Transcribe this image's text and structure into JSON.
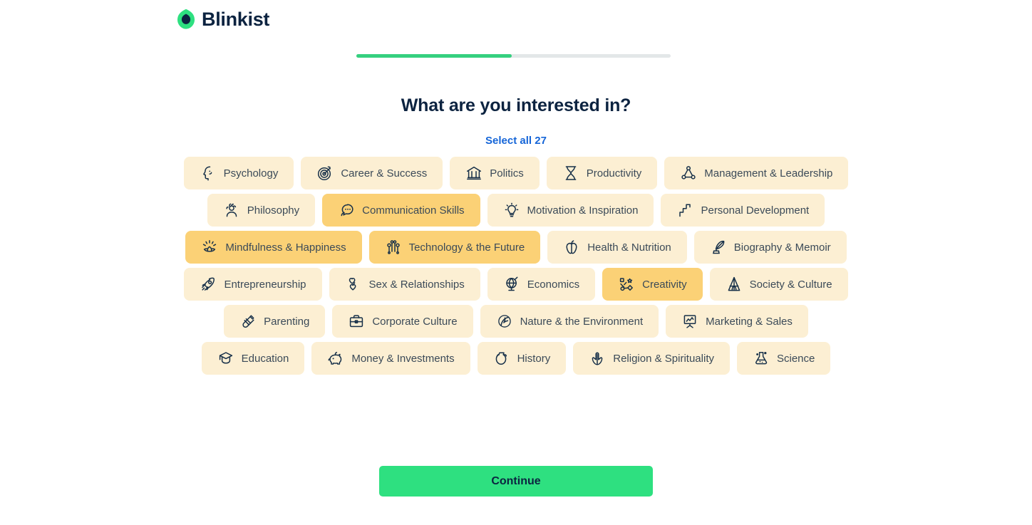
{
  "brand": {
    "name": "Blinkist",
    "logo_icon": "blinkist-droplet-logo",
    "logo_green": "#2ee080",
    "logo_navy": "#0c2340"
  },
  "progress": {
    "percent": 49.5,
    "fill_color": "#35d07f",
    "track_color": "#e3e7e8"
  },
  "heading": {
    "title": "What are you interested in?",
    "select_all_label": "Select all 27",
    "link_color": "#1565d8"
  },
  "chips": {
    "unselected_bg": "#fcefd3",
    "selected_bg": "#fbd176",
    "rows": [
      [
        {
          "label": "Psychology",
          "icon": "head-profile-icon",
          "selected": false
        },
        {
          "label": "Career & Success",
          "icon": "target-arrow-icon",
          "selected": false
        },
        {
          "label": "Politics",
          "icon": "bank-columns-icon",
          "selected": false
        },
        {
          "label": "Productivity",
          "icon": "hourglass-icon",
          "selected": false
        },
        {
          "label": "Management & Leadership",
          "icon": "network-nodes-icon",
          "selected": false
        }
      ],
      [
        {
          "label": "Philosophy",
          "icon": "thinker-person-icon",
          "selected": false
        },
        {
          "label": "Communication Skills",
          "icon": "speech-bubble-icon",
          "selected": true
        },
        {
          "label": "Motivation & Inspiration",
          "icon": "lightbulb-icon",
          "selected": false
        },
        {
          "label": "Personal Development",
          "icon": "stairs-arrow-icon",
          "selected": false
        }
      ],
      [
        {
          "label": "Mindfulness & Happiness",
          "icon": "lotus-flower-icon",
          "selected": true
        },
        {
          "label": "Technology & the Future",
          "icon": "circuit-board-icon",
          "selected": true
        },
        {
          "label": "Health & Nutrition",
          "icon": "apple-icon",
          "selected": false
        },
        {
          "label": "Biography & Memoir",
          "icon": "quill-inkwell-icon",
          "selected": false
        }
      ],
      [
        {
          "label": "Entrepreneurship",
          "icon": "rocket-icon",
          "selected": false
        },
        {
          "label": "Sex & Relationships",
          "icon": "two-hearts-icon",
          "selected": false
        },
        {
          "label": "Economics",
          "icon": "globe-stand-icon",
          "selected": false
        },
        {
          "label": "Creativity",
          "icon": "shapes-scatter-icon",
          "selected": true
        },
        {
          "label": "Society & Culture",
          "icon": "teepee-tent-icon",
          "selected": false
        }
      ],
      [
        {
          "label": "Parenting",
          "icon": "baby-bottle-icon",
          "selected": false
        },
        {
          "label": "Corporate Culture",
          "icon": "briefcase-icon",
          "selected": false
        },
        {
          "label": "Nature & the Environment",
          "icon": "leaf-icon",
          "selected": false
        },
        {
          "label": "Marketing & Sales",
          "icon": "presentation-chart-icon",
          "selected": false
        }
      ],
      [
        {
          "label": "Education",
          "icon": "graduation-cap-icon",
          "selected": false
        },
        {
          "label": "Money & Investments",
          "icon": "piggy-bank-icon",
          "selected": false
        },
        {
          "label": "History",
          "icon": "amphora-vase-icon",
          "selected": false
        },
        {
          "label": "Religion & Spirituality",
          "icon": "praying-hands-icon",
          "selected": false
        },
        {
          "label": "Science",
          "icon": "lab-flask-icon",
          "selected": false
        }
      ]
    ]
  },
  "footer": {
    "continue_label": "Continue",
    "continue_color": "#2ee080"
  }
}
